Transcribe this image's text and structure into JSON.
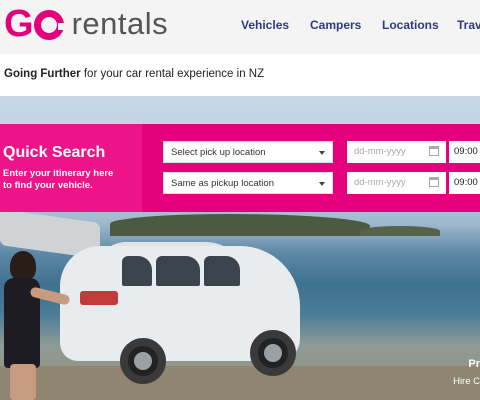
{
  "brand": {
    "go": "G",
    "name": "rentals",
    "accent": "#e3007b"
  },
  "nav": [
    "Vehicles",
    "Campers",
    "Locations",
    "Trave"
  ],
  "tagline": {
    "bold": "Going Further",
    "rest": " for your car rental experience in NZ"
  },
  "quick_search": {
    "title": "Quick Search",
    "subtitle_line1": "Enter your itinerary here",
    "subtitle_line2": "to find your vehicle.",
    "pickup_select": "Select pick up location",
    "dropoff_select": "Same as pickup location",
    "pickup_date_placeholder": "dd-mm-yyyy",
    "dropoff_date_placeholder": "dd-mm-yyyy",
    "pickup_time": "09:00",
    "dropoff_time": "09:00"
  },
  "promo": {
    "line1": "Pr",
    "line2": "Hire C"
  }
}
